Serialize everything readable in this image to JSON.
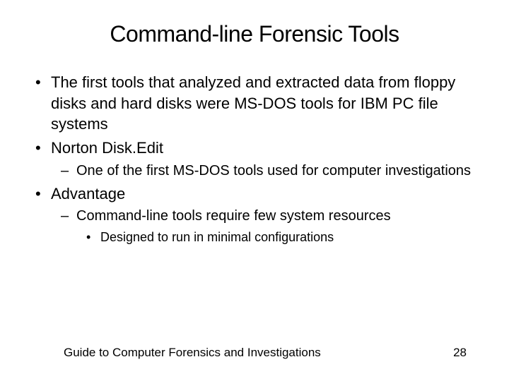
{
  "title": "Command-line Forensic Tools",
  "bullets": {
    "b1": "The first tools that analyzed and extracted data from floppy disks and hard disks were MS-DOS tools for IBM PC file systems",
    "b2": "Norton Disk.Edit",
    "b2_1": "One of the first MS-DOS tools used for computer investigations",
    "b3": "Advantage",
    "b3_1": "Command-line tools require few system resources",
    "b3_1_1": "Designed to run in minimal configurations"
  },
  "footer": {
    "text": "Guide to Computer Forensics and Investigations",
    "page": "28"
  }
}
